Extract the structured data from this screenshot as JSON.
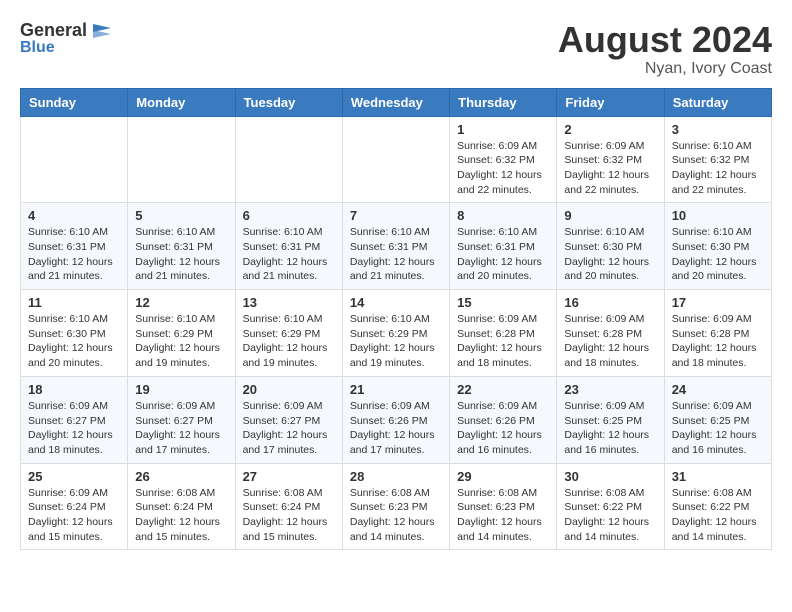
{
  "logo": {
    "general": "General",
    "blue": "Blue",
    "tagline": "Blue"
  },
  "header": {
    "title": "August 2024",
    "subtitle": "Nyan, Ivory Coast"
  },
  "days_of_week": [
    "Sunday",
    "Monday",
    "Tuesday",
    "Wednesday",
    "Thursday",
    "Friday",
    "Saturday"
  ],
  "weeks": [
    [
      {
        "day": "",
        "info": ""
      },
      {
        "day": "",
        "info": ""
      },
      {
        "day": "",
        "info": ""
      },
      {
        "day": "",
        "info": ""
      },
      {
        "day": "1",
        "info": "Sunrise: 6:09 AM\nSunset: 6:32 PM\nDaylight: 12 hours\nand 22 minutes."
      },
      {
        "day": "2",
        "info": "Sunrise: 6:09 AM\nSunset: 6:32 PM\nDaylight: 12 hours\nand 22 minutes."
      },
      {
        "day": "3",
        "info": "Sunrise: 6:10 AM\nSunset: 6:32 PM\nDaylight: 12 hours\nand 22 minutes."
      }
    ],
    [
      {
        "day": "4",
        "info": "Sunrise: 6:10 AM\nSunset: 6:31 PM\nDaylight: 12 hours\nand 21 minutes."
      },
      {
        "day": "5",
        "info": "Sunrise: 6:10 AM\nSunset: 6:31 PM\nDaylight: 12 hours\nand 21 minutes."
      },
      {
        "day": "6",
        "info": "Sunrise: 6:10 AM\nSunset: 6:31 PM\nDaylight: 12 hours\nand 21 minutes."
      },
      {
        "day": "7",
        "info": "Sunrise: 6:10 AM\nSunset: 6:31 PM\nDaylight: 12 hours\nand 21 minutes."
      },
      {
        "day": "8",
        "info": "Sunrise: 6:10 AM\nSunset: 6:31 PM\nDaylight: 12 hours\nand 20 minutes."
      },
      {
        "day": "9",
        "info": "Sunrise: 6:10 AM\nSunset: 6:30 PM\nDaylight: 12 hours\nand 20 minutes."
      },
      {
        "day": "10",
        "info": "Sunrise: 6:10 AM\nSunset: 6:30 PM\nDaylight: 12 hours\nand 20 minutes."
      }
    ],
    [
      {
        "day": "11",
        "info": "Sunrise: 6:10 AM\nSunset: 6:30 PM\nDaylight: 12 hours\nand 20 minutes."
      },
      {
        "day": "12",
        "info": "Sunrise: 6:10 AM\nSunset: 6:29 PM\nDaylight: 12 hours\nand 19 minutes."
      },
      {
        "day": "13",
        "info": "Sunrise: 6:10 AM\nSunset: 6:29 PM\nDaylight: 12 hours\nand 19 minutes."
      },
      {
        "day": "14",
        "info": "Sunrise: 6:10 AM\nSunset: 6:29 PM\nDaylight: 12 hours\nand 19 minutes."
      },
      {
        "day": "15",
        "info": "Sunrise: 6:09 AM\nSunset: 6:28 PM\nDaylight: 12 hours\nand 18 minutes."
      },
      {
        "day": "16",
        "info": "Sunrise: 6:09 AM\nSunset: 6:28 PM\nDaylight: 12 hours\nand 18 minutes."
      },
      {
        "day": "17",
        "info": "Sunrise: 6:09 AM\nSunset: 6:28 PM\nDaylight: 12 hours\nand 18 minutes."
      }
    ],
    [
      {
        "day": "18",
        "info": "Sunrise: 6:09 AM\nSunset: 6:27 PM\nDaylight: 12 hours\nand 18 minutes."
      },
      {
        "day": "19",
        "info": "Sunrise: 6:09 AM\nSunset: 6:27 PM\nDaylight: 12 hours\nand 17 minutes."
      },
      {
        "day": "20",
        "info": "Sunrise: 6:09 AM\nSunset: 6:27 PM\nDaylight: 12 hours\nand 17 minutes."
      },
      {
        "day": "21",
        "info": "Sunrise: 6:09 AM\nSunset: 6:26 PM\nDaylight: 12 hours\nand 17 minutes."
      },
      {
        "day": "22",
        "info": "Sunrise: 6:09 AM\nSunset: 6:26 PM\nDaylight: 12 hours\nand 16 minutes."
      },
      {
        "day": "23",
        "info": "Sunrise: 6:09 AM\nSunset: 6:25 PM\nDaylight: 12 hours\nand 16 minutes."
      },
      {
        "day": "24",
        "info": "Sunrise: 6:09 AM\nSunset: 6:25 PM\nDaylight: 12 hours\nand 16 minutes."
      }
    ],
    [
      {
        "day": "25",
        "info": "Sunrise: 6:09 AM\nSunset: 6:24 PM\nDaylight: 12 hours\nand 15 minutes."
      },
      {
        "day": "26",
        "info": "Sunrise: 6:08 AM\nSunset: 6:24 PM\nDaylight: 12 hours\nand 15 minutes."
      },
      {
        "day": "27",
        "info": "Sunrise: 6:08 AM\nSunset: 6:24 PM\nDaylight: 12 hours\nand 15 minutes."
      },
      {
        "day": "28",
        "info": "Sunrise: 6:08 AM\nSunset: 6:23 PM\nDaylight: 12 hours\nand 14 minutes."
      },
      {
        "day": "29",
        "info": "Sunrise: 6:08 AM\nSunset: 6:23 PM\nDaylight: 12 hours\nand 14 minutes."
      },
      {
        "day": "30",
        "info": "Sunrise: 6:08 AM\nSunset: 6:22 PM\nDaylight: 12 hours\nand 14 minutes."
      },
      {
        "day": "31",
        "info": "Sunrise: 6:08 AM\nSunset: 6:22 PM\nDaylight: 12 hours\nand 14 minutes."
      }
    ]
  ]
}
